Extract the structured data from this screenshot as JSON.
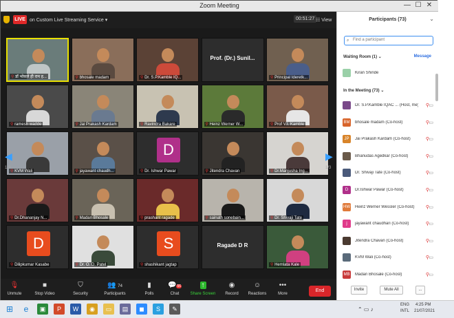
{
  "window": {
    "title": "Zoom Meeting",
    "minimize": "—",
    "maximize": "☐",
    "close": "✕"
  },
  "topbar": {
    "live": "LIVE",
    "stream": "on Custom Live Streaming Service ▾",
    "timer": "00:51:27",
    "view": "☷ View"
  },
  "tiles": [
    {
      "name": "डॉ भोसले ही राम ह...",
      "type": "video",
      "color": "#6a7c7a",
      "shirt": "#bfc6c6",
      "active": true
    },
    {
      "name": "bhosale madam",
      "type": "video",
      "color": "#8a6e5a",
      "shirt": "#5a4a40"
    },
    {
      "name": "Dr. S.P.Kamble IQ...",
      "type": "video",
      "color": "#5b4236",
      "shirt": "#cc4a3a"
    },
    {
      "name": "Prof. (Dr.) Sunil...",
      "type": "label"
    },
    {
      "name": "Principal Ideretk...",
      "type": "video",
      "color": "#706050",
      "shirt": "#4a5e8a"
    },
    {
      "name": "ramesh wadde",
      "type": "video",
      "color": "#4a4a4a",
      "shirt": "#d8d8d8"
    },
    {
      "name": "Jai Prakash Kardam",
      "type": "video",
      "color": "#8a8578",
      "shirt": "#6a7a90"
    },
    {
      "name": "Ravindra Bakare",
      "type": "video",
      "color": "#c8c2b2",
      "shirt": "#2e3a4e"
    },
    {
      "name": "Heinz Werner W...",
      "type": "video",
      "color": "#5c7a3a",
      "shirt": "#2a2a2a"
    },
    {
      "name": "Prof V.I. Kamble",
      "type": "video",
      "color": "#7a5a4a",
      "shirt": "#e6e6e6"
    },
    {
      "name": "KVM Wali",
      "type": "video",
      "color": "#9aa0a8",
      "shirt": "#3a3a3a"
    },
    {
      "name": "jayawant chaudh...",
      "type": "video",
      "color": "#5a5048",
      "shirt": "#5a7a9a"
    },
    {
      "name": "Dr. Ishwar Pawar",
      "type": "avatar",
      "letter": "D",
      "bg": "#b0308a"
    },
    {
      "name": "Jitendra Chavan",
      "type": "video",
      "color": "#3a3632",
      "shirt": "#222"
    },
    {
      "name": "Dr.Manjusha Ing...",
      "type": "video",
      "color": "#d6d4d0",
      "shirt": "#4a3a3a"
    },
    {
      "name": "Dr.Dhananjay N...",
      "type": "video",
      "color": "#6a3a3a",
      "shirt": "#1a1a1a"
    },
    {
      "name": "Madan Bhosale",
      "type": "video",
      "color": "#6a6458",
      "shirt": "#c8c0b0"
    },
    {
      "name": "prashant ragade",
      "type": "video",
      "color": "#6a2a2a",
      "shirt": "#e8c04a"
    },
    {
      "name": "sainath sonebain...",
      "type": "video",
      "color": "#b8b4ac",
      "shirt": "#1a1a1a"
    },
    {
      "name": "Dr. Shivaji Tate",
      "type": "video",
      "color": "#d8d8d8",
      "shirt": "#1e2a40"
    },
    {
      "name": "Dilipkumar Kasabe",
      "type": "avatar",
      "letter": "D",
      "bg": "#e84c1e"
    },
    {
      "name": "Dr. O. D. Patel",
      "type": "video",
      "color": "#e0e0e0",
      "shirt": "#3a4a3a"
    },
    {
      "name": "shashikant jagtap",
      "type": "avatar",
      "letter": "S",
      "bg": "#e84c1e"
    },
    {
      "name": "Ragade D R",
      "type": "label"
    },
    {
      "name": "Hemlata Kale",
      "type": "video",
      "color": "#3a5a3a",
      "shirt": "#d04080"
    }
  ],
  "paging": {
    "left": "1/3",
    "right": "1/3"
  },
  "toolbar": {
    "unmute": "Unmute",
    "stop_video": "Stop Video",
    "security": "Security",
    "participants": "Participants",
    "participants_count": "74",
    "polls": "Polls",
    "chat": "Chat",
    "chat_badge": "56",
    "share": "Share Screen",
    "record": "Record",
    "reactions": "Reactions",
    "more": "More",
    "end": "End"
  },
  "panel": {
    "header": "Participants (73)",
    "search_placeholder": "Find a participant",
    "waiting_room": "Waiting Room (1)  ⌄",
    "message": "Message",
    "in_meeting": "In the Meeting (73)  ⌄",
    "invite": "Invite",
    "mute_all": "Mute All",
    "more": "...",
    "waiting": [
      {
        "name": "Kiran Shinde",
        "initial": "",
        "bg": "#9ad0a8"
      }
    ],
    "participants": [
      {
        "name": "Dr. S.P.Kamble IQAC ... (Host, me)",
        "initial": "",
        "bg": "#7a4a8a"
      },
      {
        "name": "bhosale madam (Co-host)",
        "initial": "BM",
        "bg": "#d8642a"
      },
      {
        "name": "Jai Prakash Kardam (Co-host)",
        "initial": "JP",
        "bg": "#d8842a"
      },
      {
        "name": "Bhanudas Agedkar (Co-host)",
        "initial": "",
        "bg": "#6a5a4a"
      },
      {
        "name": "Dr. Shivaji Tate (Co-host)",
        "initial": "",
        "bg": "#4a5a7a"
      },
      {
        "name": "Dr.Ishwar Pawar (Co-host)",
        "initial": "D",
        "bg": "#b0308a"
      },
      {
        "name": "Heinz Werner Wessler (Co-host)",
        "initial": "HW",
        "bg": "#e07a3a"
      },
      {
        "name": "jayawant chaudhari (Co-host)",
        "initial": "j",
        "bg": "#e03a8a"
      },
      {
        "name": "Jitendra Chavan (Co-host)",
        "initial": "",
        "bg": "#4a3a30"
      },
      {
        "name": "KVM Wali (Co-host)",
        "initial": "",
        "bg": "#5a6a7a"
      },
      {
        "name": "Madan Bhosale (Co-host)",
        "initial": "MB",
        "bg": "#c83a3a"
      }
    ]
  },
  "taskbar": {
    "lang": "ENG",
    "region": "INTL",
    "time": "4:25 PM",
    "date": "21/07/2021"
  }
}
